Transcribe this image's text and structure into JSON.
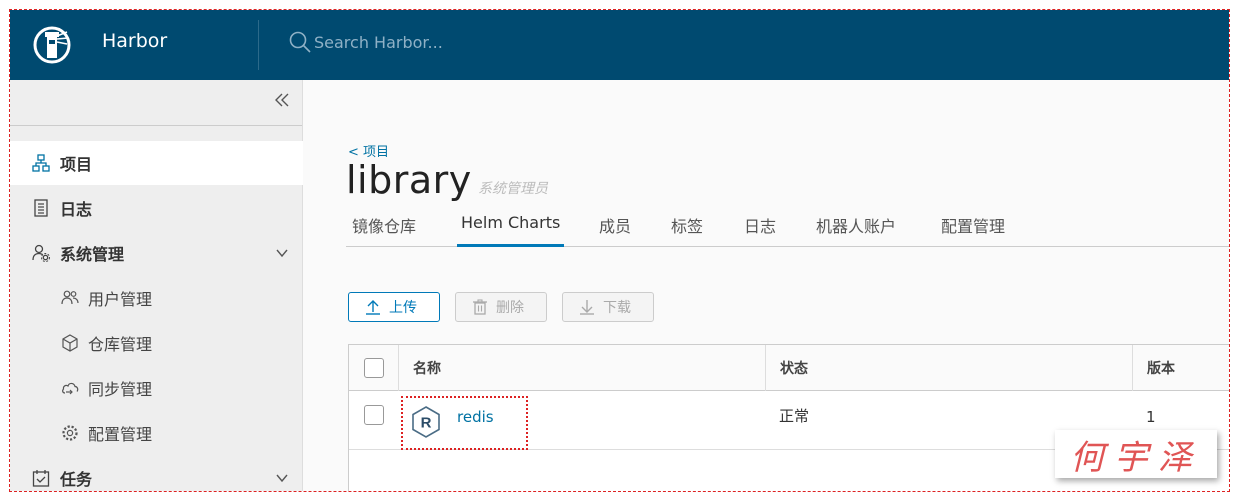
{
  "header": {
    "brand": "Harbor",
    "search_placeholder": "Search Harbor..."
  },
  "sidebar": {
    "items": [
      {
        "label": "项目",
        "icon": "projects-icon",
        "active": true
      },
      {
        "label": "日志",
        "icon": "logs-icon"
      },
      {
        "label": "系统管理",
        "icon": "admin-icon",
        "expandable": true
      },
      {
        "label": "用户管理",
        "icon": "users-icon",
        "sub": true
      },
      {
        "label": "仓库管理",
        "icon": "registry-icon",
        "sub": true
      },
      {
        "label": "同步管理",
        "icon": "replication-icon",
        "sub": true
      },
      {
        "label": "配置管理",
        "icon": "settings-icon",
        "sub": true
      },
      {
        "label": "任务",
        "icon": "tasks-icon",
        "expandable": true
      }
    ]
  },
  "project": {
    "back_link": "< 项目",
    "name": "library",
    "role": "系统管理员"
  },
  "tabs": [
    "镜像仓库",
    "Helm Charts",
    "成员",
    "标签",
    "日志",
    "机器人账户",
    "配置管理"
  ],
  "active_tab": "Helm Charts",
  "toolbar": {
    "upload": "上传",
    "delete": "删除",
    "download": "下载"
  },
  "table": {
    "columns": [
      "名称",
      "状态",
      "版本"
    ],
    "rows": [
      {
        "name": "redis",
        "status": "正常",
        "version": "1"
      }
    ]
  },
  "watermark": "何宇泽",
  "colors": {
    "header_bg": "#004a70",
    "accent": "#0079b8",
    "annotation": "#d22222"
  }
}
